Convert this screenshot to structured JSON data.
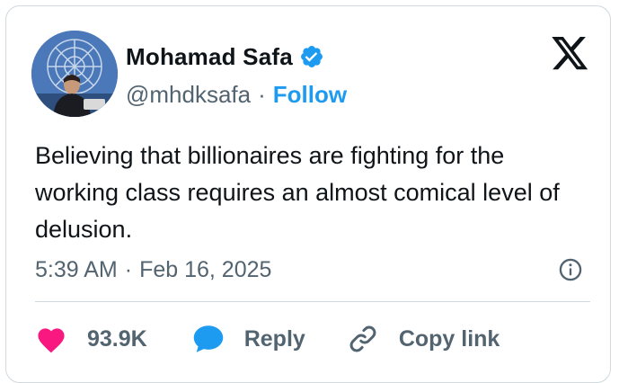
{
  "author": {
    "name": "Mohamad Safa",
    "handle": "@mhdksafa",
    "separator": "·",
    "follow_label": "Follow",
    "verified_icon": "verified-badge-icon",
    "avatar_icon": "profile-avatar"
  },
  "brand": {
    "logo_icon": "x-logo-icon"
  },
  "tweet": {
    "text": "Believing that billionaires are fighting for the working class requires an almost comical level of delusion.",
    "time": "5:39 AM",
    "separator": "·",
    "date": "Feb 16, 2025",
    "info_icon": "info-icon"
  },
  "actions": {
    "like_count": "93.9K",
    "reply_label": "Reply",
    "copy_link_label": "Copy link"
  },
  "colors": {
    "accent": "#1d9bf0",
    "heart": "#f91880",
    "text": "#0f1419",
    "muted": "#536471",
    "border": "#cfd9de"
  }
}
